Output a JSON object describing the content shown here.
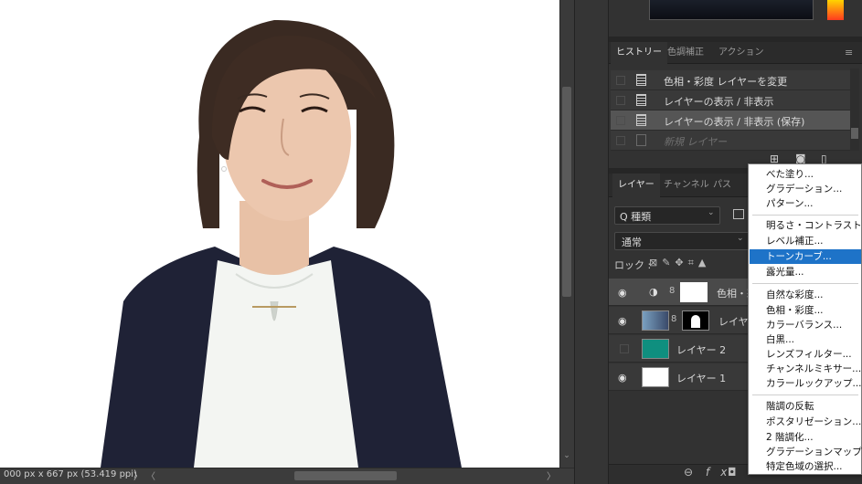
{
  "status_bar": {
    "doc_info": "000 px x 667 px (53.419 ppi)",
    "arrow": "〉",
    "scroll_left": "〈",
    "scroll_right": "〉"
  },
  "history_panel": {
    "tabs": [
      "ヒストリー",
      "色調補正",
      "アクション"
    ],
    "menu_icon": "≡",
    "items": [
      {
        "label": "色相・彩度 レイヤーを変更",
        "state": "normal"
      },
      {
        "label": "レイヤーの表示 / 非表示",
        "state": "normal"
      },
      {
        "label": "レイヤーの表示 / 非表示 (保存)",
        "state": "selected"
      },
      {
        "label": "新規 レイヤー",
        "state": "ghost"
      }
    ],
    "tool_icons": [
      "new-snapshot-icon",
      "camera-icon",
      "trash-icon"
    ]
  },
  "layers_panel": {
    "tabs": [
      "レイヤー",
      "チャンネル",
      "パス"
    ],
    "filter_label": "Q 種類",
    "blend_mode": "通常",
    "lock_label": "ロック :",
    "layers": [
      {
        "name": "色相・彩",
        "visible": true,
        "type": "adjustment"
      },
      {
        "name": "レイヤー",
        "visible": true,
        "type": "photo-masked"
      },
      {
        "name": "レイヤー 2",
        "visible": false,
        "type": "teal-fill"
      },
      {
        "name": "レイヤー 1",
        "visible": true,
        "type": "white-fill"
      }
    ],
    "footer_icons": [
      "link-icon",
      "fx-icon",
      "mask-icon"
    ],
    "fx_label": "fx"
  },
  "adjustment_menu": {
    "groups": [
      [
        "べた塗り...",
        "グラデーション...",
        "パターン..."
      ],
      [
        "明るさ・コントラスト...",
        "レベル補正...",
        "トーンカーブ...",
        "露光量..."
      ],
      [
        "自然な彩度...",
        "色相・彩度...",
        "カラーバランス...",
        "白黒...",
        "レンズフィルター...",
        "チャンネルミキサー...",
        "カラールックアップ..."
      ],
      [
        "階調の反転",
        "ポスタリゼーション...",
        "2 階調化...",
        "グラデーションマップ...",
        "特定色域の選択..."
      ]
    ],
    "highlighted": "トーンカーブ..."
  },
  "colors": {
    "menu_highlight": "#1e73c8",
    "teal_layer": "#0f8f7f",
    "panel_bg": "#323232"
  }
}
